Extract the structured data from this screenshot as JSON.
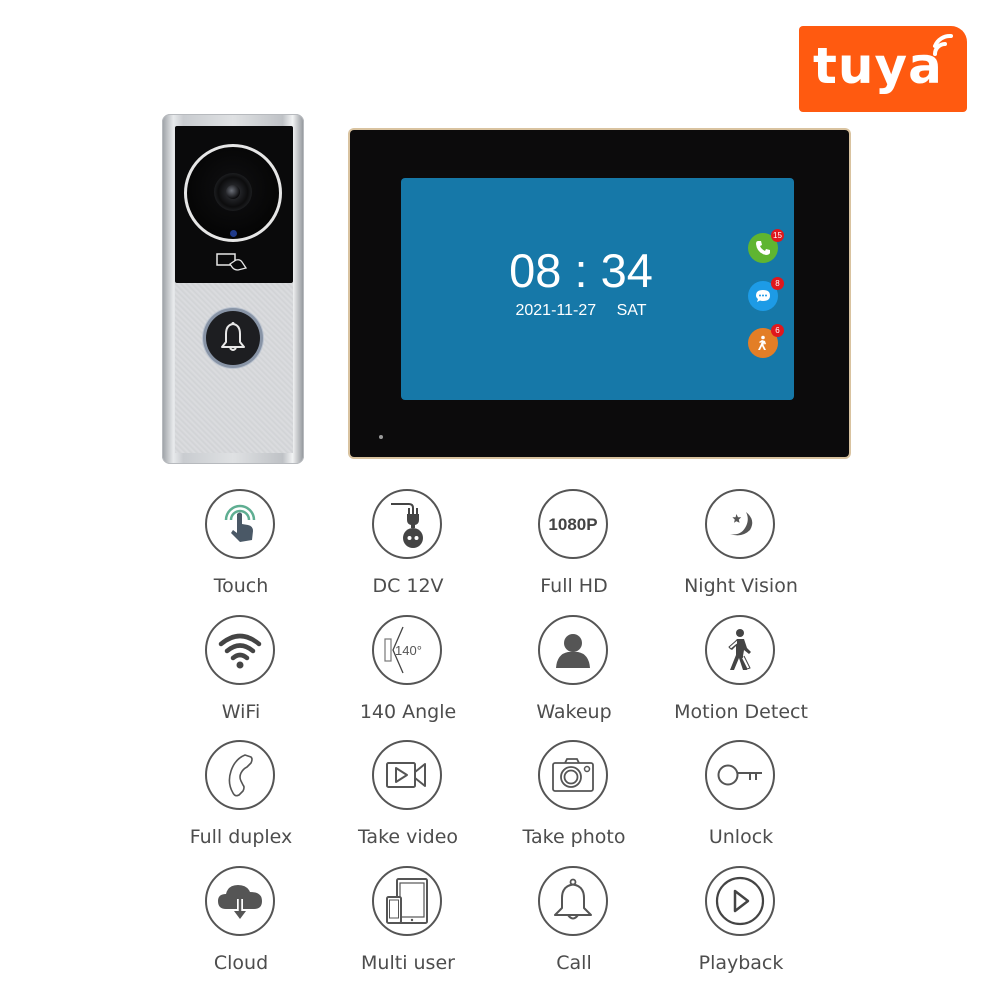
{
  "brand": {
    "name": "tuya",
    "color": "#ff5a10"
  },
  "doorbell": {
    "product": "video-doorbell",
    "icons": [
      "camera-lens-icon",
      "rfid-card-icon",
      "bell-icon"
    ]
  },
  "monitor": {
    "screen": {
      "time_hours": "08",
      "time_separator": ":",
      "time_minutes": "34",
      "date": "2021-11-27",
      "weekday": "SAT",
      "background_color": "#1678a8"
    },
    "notifications": [
      {
        "icon": "phone-icon",
        "count": "15",
        "color": "#5fb531"
      },
      {
        "icon": "message-icon",
        "count": "8",
        "color": "#1d9be6"
      },
      {
        "icon": "motion-icon",
        "count": "6",
        "color": "#e37e26"
      }
    ]
  },
  "features": [
    {
      "label": "Touch",
      "icon": "touch-icon"
    },
    {
      "label": "DC 12V",
      "icon": "power-plug-icon"
    },
    {
      "label": "Full HD",
      "icon": "1080p-icon",
      "icon_text": "1080P"
    },
    {
      "label": "Night Vision",
      "icon": "moon-icon"
    },
    {
      "label": "WiFi",
      "icon": "wifi-icon"
    },
    {
      "label": "140 Angle",
      "icon": "angle-icon",
      "icon_text": "140°"
    },
    {
      "label": "Wakeup",
      "icon": "person-icon"
    },
    {
      "label": "Motion Detect",
      "icon": "walking-person-icon"
    },
    {
      "label": "Full duplex",
      "icon": "phone-handset-icon"
    },
    {
      "label": "Take video",
      "icon": "video-camera-icon"
    },
    {
      "label": "Take photo",
      "icon": "camera-icon"
    },
    {
      "label": "Unlock",
      "icon": "key-icon"
    },
    {
      "label": "Cloud",
      "icon": "cloud-download-icon"
    },
    {
      "label": "Multi user",
      "icon": "devices-icon"
    },
    {
      "label": "Call",
      "icon": "bell-icon"
    },
    {
      "label": "Playback",
      "icon": "play-circle-icon"
    }
  ]
}
